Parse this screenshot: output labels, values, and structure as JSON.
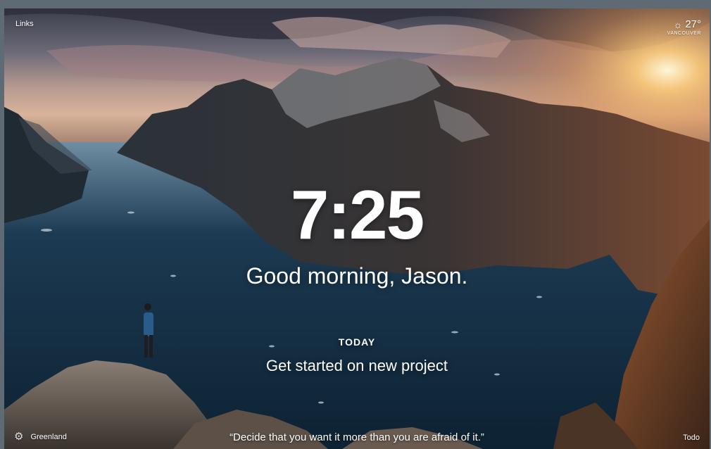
{
  "top_left": {
    "links_label": "Links"
  },
  "weather": {
    "icon": "sun-icon",
    "temperature": "27°",
    "location": "VANCOUVER"
  },
  "main": {
    "time": "7:25",
    "greeting": "Good morning, Jason.",
    "focus_heading": "TODAY",
    "focus_text": "Get started on new project"
  },
  "bottom": {
    "settings_icon": "gear-icon",
    "photo_location": "Greenland",
    "quote": "“Decide that you want it more than you are afraid of it.”",
    "todo_label": "Todo"
  },
  "colors": {
    "frame": "#5e6a74",
    "text": "#ffffff"
  }
}
